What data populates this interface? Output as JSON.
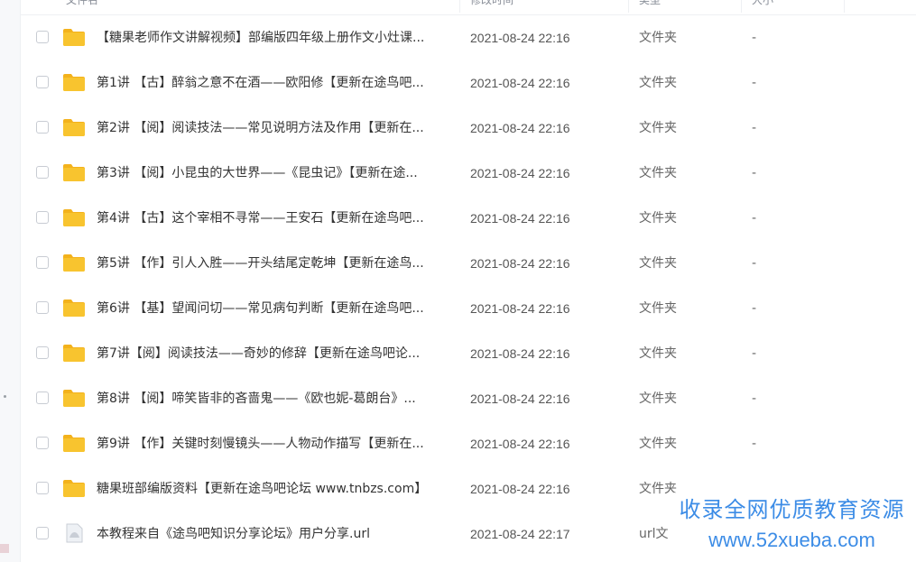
{
  "header": {
    "col_name": "文件名",
    "col_mtime": "修改时间",
    "col_type": "类型",
    "col_size": "大小"
  },
  "colors": {
    "folder": "#f8c42f",
    "folder_tab": "#f3b21c",
    "watermark": "#3c8ce6"
  },
  "rows": [
    {
      "icon": "folder-icon",
      "name": "【糖果老师作文讲解视频】部编版四年级上册作文小灶课...",
      "mtime": "2021-08-24 22:16",
      "type": "文件夹",
      "size": "-"
    },
    {
      "icon": "folder-icon",
      "name": "第1讲 【古】醉翁之意不在酒——欧阳修【更新在途鸟吧...",
      "mtime": "2021-08-24 22:16",
      "type": "文件夹",
      "size": "-"
    },
    {
      "icon": "folder-icon",
      "name": "第2讲 【阅】阅读技法——常见说明方法及作用【更新在...",
      "mtime": "2021-08-24 22:16",
      "type": "文件夹",
      "size": "-"
    },
    {
      "icon": "folder-icon",
      "name": "第3讲 【阅】小昆虫的大世界——《昆虫记》【更新在途...",
      "mtime": "2021-08-24 22:16",
      "type": "文件夹",
      "size": "-"
    },
    {
      "icon": "folder-icon",
      "name": "第4讲 【古】这个宰相不寻常——王安石【更新在途鸟吧...",
      "mtime": "2021-08-24 22:16",
      "type": "文件夹",
      "size": "-"
    },
    {
      "icon": "folder-icon",
      "name": "第5讲 【作】引人入胜——开头结尾定乾坤【更新在途鸟...",
      "mtime": "2021-08-24 22:16",
      "type": "文件夹",
      "size": "-"
    },
    {
      "icon": "folder-icon",
      "name": "第6讲 【基】望闻问切——常见病句判断【更新在途鸟吧...",
      "mtime": "2021-08-24 22:16",
      "type": "文件夹",
      "size": "-"
    },
    {
      "icon": "folder-icon",
      "name": "第7讲【阅】阅读技法——奇妙的修辞【更新在途鸟吧论...",
      "mtime": "2021-08-24 22:16",
      "type": "文件夹",
      "size": "-"
    },
    {
      "icon": "folder-icon",
      "name": "第8讲 【阅】啼笑皆非的吝啬鬼——《欧也妮-葛朗台》...",
      "mtime": "2021-08-24 22:16",
      "type": "文件夹",
      "size": "-"
    },
    {
      "icon": "folder-icon",
      "name": "第9讲 【作】关键时刻慢镜头——人物动作描写【更新在...",
      "mtime": "2021-08-24 22:16",
      "type": "文件夹",
      "size": "-"
    },
    {
      "icon": "folder-icon",
      "name": "糖果班部编版资料【更新在途鸟吧论坛 www.tnbzs.com】",
      "mtime": "2021-08-24 22:16",
      "type": "文件夹",
      "size": ""
    },
    {
      "icon": "file-icon",
      "name": "本教程来自《途鸟吧知识分享论坛》用户分享.url",
      "mtime": "2021-08-24 22:17",
      "type": "url文",
      "size": ""
    }
  ],
  "watermark": {
    "line1": "收录全网优质教育资源",
    "line2": "www.52xueba.com"
  }
}
